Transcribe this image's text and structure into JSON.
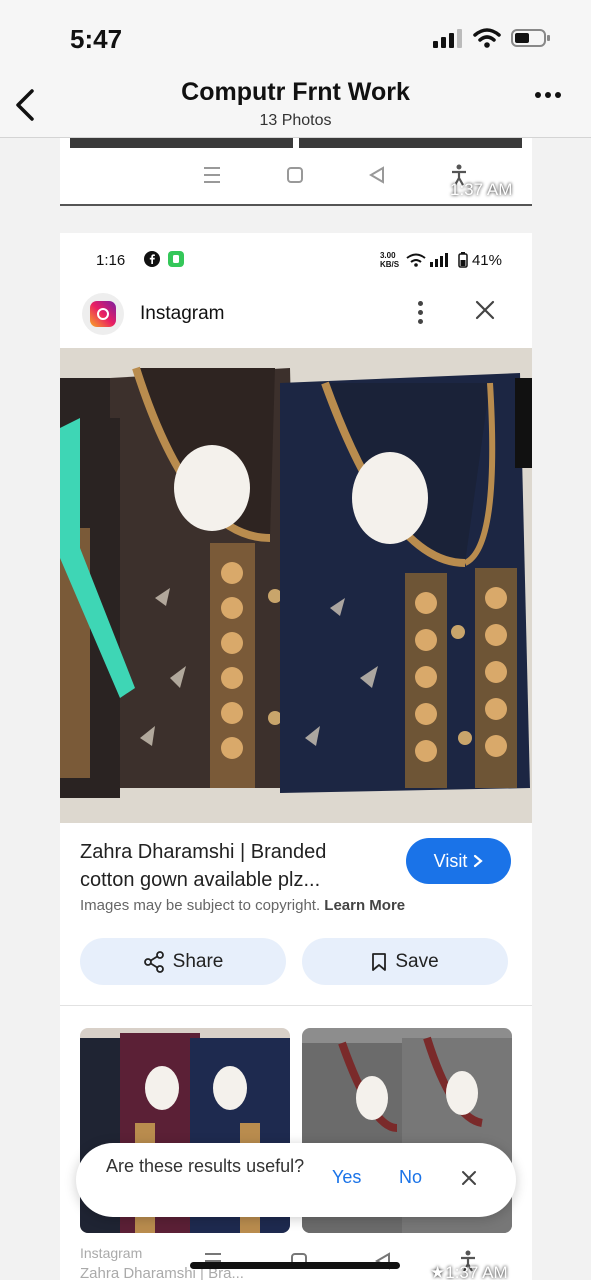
{
  "status_bar": {
    "time": "5:47"
  },
  "nav": {
    "title": "Computr Frnt Work",
    "subtitle": "13 Photos"
  },
  "prev_photo": {
    "timestamp": "1:37 AM"
  },
  "inner": {
    "status_time": "1:16",
    "status_right": "3.00 KB/S",
    "battery": "41%",
    "app_name": "Instagram",
    "result_title": "Zahra Dharamshi | Branded cotton gown available plz...",
    "visit_label": "Visit",
    "copyright_text": "Images may be subject to copyright.",
    "learn_more": "Learn More",
    "share_label": "Share",
    "save_label": "Save",
    "thumb_source": "Instagram",
    "thumb_title": "Zahra Dharamshi | Bra...",
    "timestamp": "1:37 AM"
  },
  "toast": {
    "question": "Are these results useful?",
    "yes": "Yes",
    "no": "No"
  },
  "colors": {
    "accent": "#1a73e8",
    "pill_bg": "#e7effb"
  }
}
